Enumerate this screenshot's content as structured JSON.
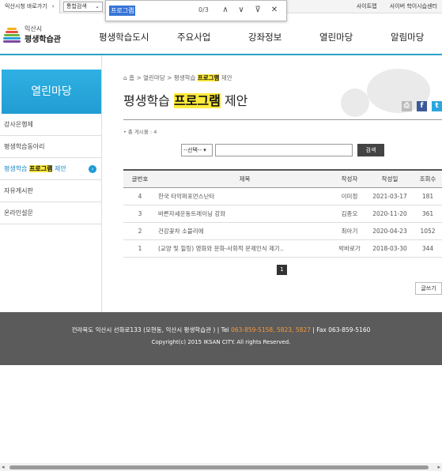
{
  "topbar": {
    "quick_label": "익산시청 바로가기",
    "quick_arrow": "›",
    "select_value": "통합검색",
    "links": [
      "사이트맵",
      "사이버 학이시습센터"
    ]
  },
  "findbar": {
    "query": "프로그램",
    "count": "0/3",
    "up": "∧",
    "down": "∨",
    "filter": "⊽",
    "close": "✕"
  },
  "logo": {
    "line1": "익산시",
    "line2": "평생학습관"
  },
  "gnb": [
    "평생학습도시",
    "주요사업",
    "강좌정보",
    "열린마당",
    "알림마당"
  ],
  "lnb": {
    "title": "열린마당",
    "items": [
      {
        "label": "강사은행제"
      },
      {
        "label": "평생학습동아리"
      },
      {
        "pre": "평생학습 ",
        "hl": "프로그램",
        "post": " 제안",
        "active": true
      },
      {
        "label": "자유게시판"
      },
      {
        "label": "온라인설문"
      }
    ],
    "go_icon": "›"
  },
  "breadcrumb": {
    "home": "⌂ 홈",
    "sep": ">",
    "p1": "열린마당",
    "pre": "평생학습 ",
    "hl": "프로그램",
    "post": " 제안"
  },
  "title": {
    "pre": "평생학습 ",
    "hl": "프로그램",
    "post": " 제안"
  },
  "share": {
    "print": "⎙",
    "facebook": "f",
    "twitter": "t"
  },
  "total": "• 총 게시물 : 4",
  "search": {
    "select": "--선택--",
    "select_chev": "▾",
    "button": "검색"
  },
  "table": {
    "headers": [
      "글번호",
      "제목",
      "작성자",
      "작성일",
      "조회수"
    ],
    "rows": [
      {
        "num": "4",
        "title": "한국 타악퍼포먼스난타",
        "author": "이미정",
        "date": "2021-03-17",
        "views": "181"
      },
      {
        "num": "3",
        "title": "바른자세운동트레이닝 강좌",
        "author": "김종오",
        "date": "2020-11-20",
        "views": "361"
      },
      {
        "num": "2",
        "title": "건강꽃차 소믈리에",
        "author": "최아기",
        "date": "2020-04-23",
        "views": "1052"
      },
      {
        "num": "1",
        "title": "(교양 및 힐링) 영화와 문화-사회적 문제인식 제기..",
        "author": "박바로가",
        "date": "2018-03-30",
        "views": "344"
      }
    ]
  },
  "pager": "1",
  "write_button": "글쓰기",
  "footer": {
    "addr": "전라북도 익산시 선화로133 (모현동, 익산시 평생학습관 ) | Tel ",
    "tel": "063-859-5158, 5823, 5827",
    "fax": " | Fax 063-859-5160",
    "copyright": "Copyright(c) 2015 IKSAN CITY. All rights Reserved."
  },
  "scroll": {
    "left": "◂",
    "right": "▸"
  }
}
